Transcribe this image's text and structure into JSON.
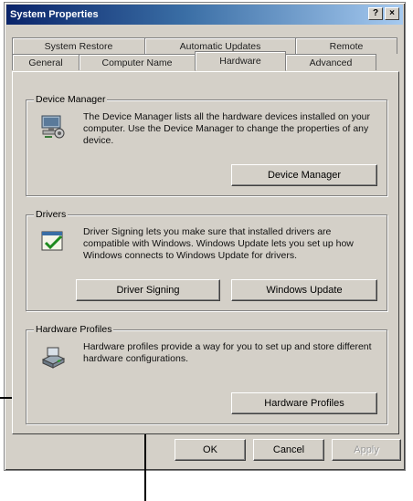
{
  "window": {
    "title": "System Properties",
    "help_label": "?",
    "close_label": "×"
  },
  "tabs": {
    "back": [
      "System Restore",
      "Automatic Updates",
      "Remote"
    ],
    "front": [
      "General",
      "Computer Name",
      "Hardware",
      "Advanced"
    ],
    "active": "Hardware"
  },
  "device_manager": {
    "legend": "Device Manager",
    "description": "The Device Manager lists all the hardware devices installed on your computer. Use the Device Manager to change the properties of any device.",
    "button": "Device Manager"
  },
  "drivers": {
    "legend": "Drivers",
    "description": "Driver Signing lets you make sure that installed drivers are compatible with Windows. Windows Update lets you set up how Windows connects to Windows Update for drivers.",
    "signing_button": "Driver Signing",
    "update_button": "Windows Update"
  },
  "hardware_profiles": {
    "legend": "Hardware Profiles",
    "description": "Hardware profiles provide a way for you to set up and store different hardware configurations.",
    "button": "Hardware Profiles"
  },
  "footer": {
    "ok": "OK",
    "cancel": "Cancel",
    "apply": "Apply"
  },
  "icons": {
    "device_manager": "device-manager-icon",
    "drivers": "drivers-icon",
    "hardware_profiles": "hardware-profiles-icon"
  }
}
